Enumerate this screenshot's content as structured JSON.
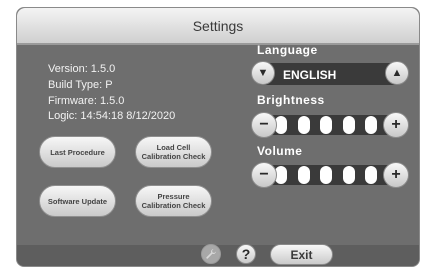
{
  "title": "Settings",
  "info": {
    "version": "Version:  1.5.0",
    "build_type": "Build Type:  P",
    "firmware": "Firmware:  1.5.0",
    "logic": "Logic:  14:54:18  8/12/2020"
  },
  "buttons": {
    "last_procedure": "Last Procedure",
    "load_cell_calibration_check": "Load Cell Calibration Check",
    "software_update": "Software Update",
    "pressure_calibration_check": "Pressure Calibration Check"
  },
  "language": {
    "heading": "Language",
    "value": "ENGLISH"
  },
  "brightness": {
    "heading": "Brightness",
    "level": 5,
    "max": 5
  },
  "volume": {
    "heading": "Volume",
    "level": 5,
    "max": 5
  },
  "footer": {
    "help_label": "?",
    "exit_label": "Exit",
    "icons": [
      "wrench-icon",
      "help-icon"
    ]
  },
  "colors": {
    "panel": "#6e6e6e",
    "slider_track": "#3a3a3a",
    "slider_step": "#ffffff",
    "title_text": "#3a3a3a"
  }
}
